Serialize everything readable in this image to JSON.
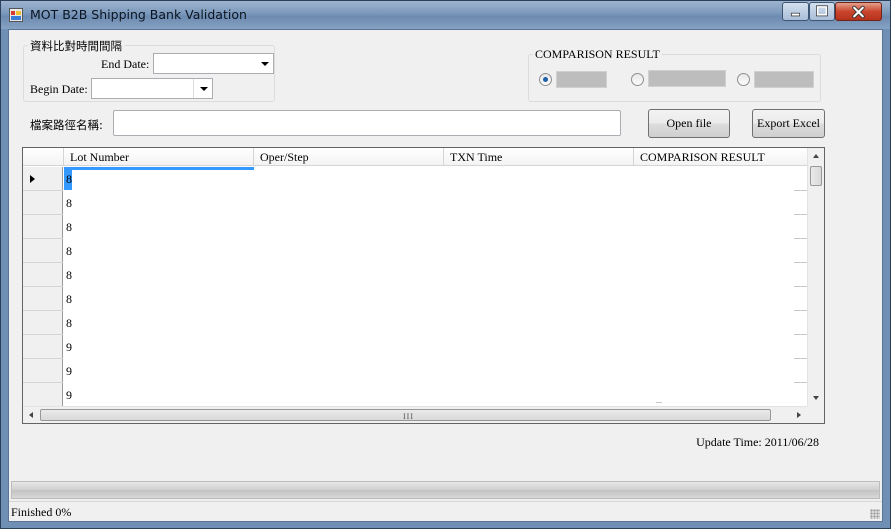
{
  "window": {
    "title": "MOT B2B Shipping Bank Validation",
    "accent": "#6f8fb4"
  },
  "date_group": {
    "legend": "資料比對時間間隔",
    "end_date_label": "End Date:",
    "end_date_value": "",
    "begin_date_label": "Begin Date:",
    "begin_date_value": ""
  },
  "comparison_group": {
    "legend": "COMPARISON RESULT",
    "options": [
      {
        "label": "",
        "selected": true
      },
      {
        "label": "",
        "selected": false
      },
      {
        "label": "",
        "selected": false
      }
    ]
  },
  "file": {
    "label": "檔案路徑名稱:",
    "path_value": "",
    "open_button": "Open file",
    "export_button": "Export Excel"
  },
  "grid": {
    "columns": [
      "Lot Number",
      "Oper/Step",
      "TXN Time",
      "COMPARISON RESULT"
    ],
    "rows": [
      {
        "lot": "8"
      },
      {
        "lot": "8"
      },
      {
        "lot": "8"
      },
      {
        "lot": "8"
      },
      {
        "lot": "8"
      },
      {
        "lot": "8"
      },
      {
        "lot": "8"
      },
      {
        "lot": "9"
      },
      {
        "lot": "9"
      },
      {
        "lot": "9"
      }
    ],
    "scroll_grip": "III",
    "selection_color": "#3399ff"
  },
  "update_time": "Update Time: 2011/06/28",
  "status": {
    "text": "Finished 0%",
    "progress": 0
  },
  "icons": {
    "app": "app-icon",
    "minimize": "minimize-icon",
    "maximize": "maximize-icon",
    "close": "close-icon"
  }
}
